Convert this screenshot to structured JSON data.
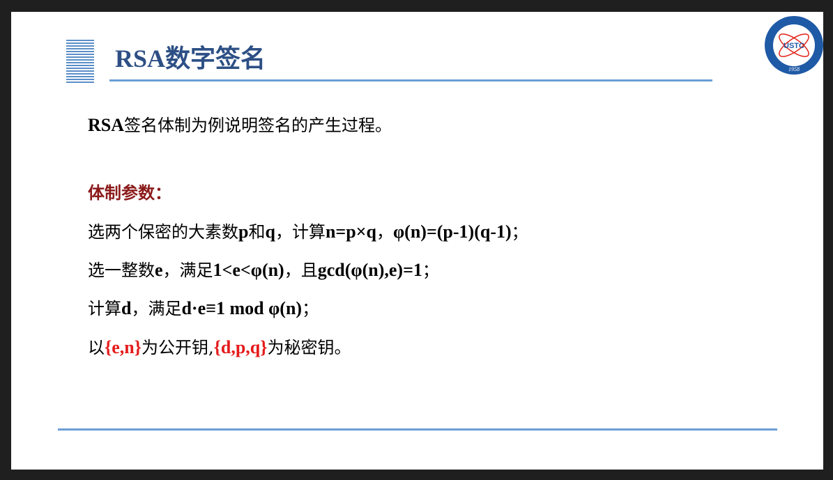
{
  "slide": {
    "title": "RSA数字签名",
    "logo": {
      "text": "USTC",
      "year": "1958"
    },
    "intro": {
      "lead": "RSA",
      "rest": "签名体制为例说明签名的产生过程。"
    },
    "params_heading": "体制参数：",
    "step1": {
      "a": "选两个保密的大素数",
      "b": "p",
      "c": "和",
      "d": "q",
      "e": "，计算",
      "f": "n=p×q",
      "g": "，",
      "h": "φ(n)=(p-1)(q-1)",
      "i": "；"
    },
    "step2": {
      "a": "选一整数",
      "b": "e",
      "c": "，满足",
      "d": "1<e<φ(n)",
      "e": "，且",
      "f": "gcd(φ(n),e)=1",
      "g": "；"
    },
    "step3": {
      "a": "计算",
      "b": "d",
      "c": "，满足",
      "d": "d·e≡1 mod φ(n)",
      "e": "；"
    },
    "step4": {
      "a": "以",
      "public_key": "{e,n}",
      "b": "为公开钥,",
      "private_key": "{d,p,q}",
      "c": "为秘密钥。"
    }
  }
}
